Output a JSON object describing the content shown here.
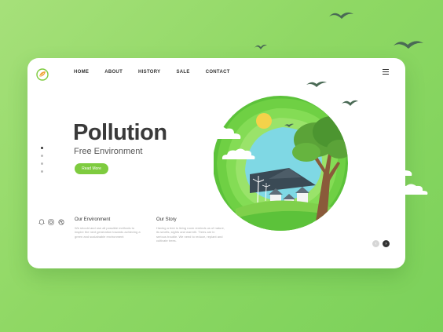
{
  "nav": {
    "items": [
      {
        "label": "HOME"
      },
      {
        "label": "ABOUT"
      },
      {
        "label": "HISTORY"
      },
      {
        "label": "SALE"
      },
      {
        "label": "CONTACT"
      }
    ]
  },
  "hero": {
    "title": "Pollution",
    "subtitle": "Free Environment",
    "cta_label": "Read More"
  },
  "pager": {
    "total": 4,
    "active_index": 0
  },
  "social": [
    "snapchat-icon",
    "instagram-icon",
    "dribbble-icon"
  ],
  "sections": [
    {
      "title": "Our Environment",
      "text": "We should and use all possible methods to inspire the next generation towards achieving a green and sustainable environment"
    },
    {
      "title": "Our Story",
      "text": "Having a tree is living room reminds us of nature, its smells, sights and warmth. Trees are in serious trouble. We need to reduce, replant and cultivate trees."
    }
  ],
  "colors": {
    "accent": "#7ecb3f",
    "background": "#8fd864",
    "dark": "#333333"
  }
}
